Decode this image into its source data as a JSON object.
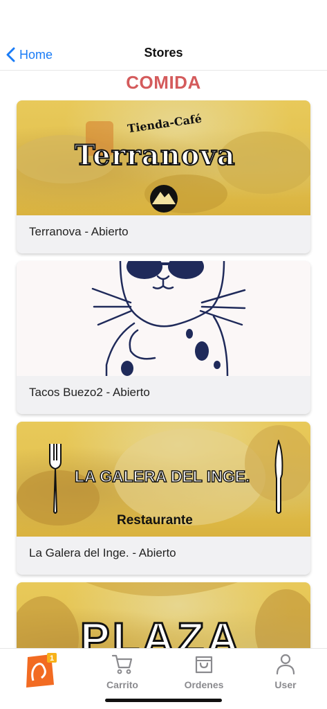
{
  "nav": {
    "back_label": "Home",
    "title": "Stores"
  },
  "section": {
    "title": "COMIDA"
  },
  "stores": [
    {
      "label": "Terranova - Abierto",
      "logo_top": "Tienda-Café",
      "logo_main": "Terranova"
    },
    {
      "label": "Tacos Buezo2 - Abierto"
    },
    {
      "label": "La Galera del Inge. - Abierto",
      "logo_main": "LA GALERA DEL INGE.",
      "logo_sub": "Restaurante"
    },
    {
      "logo_main": "PLAZA"
    }
  ],
  "tabs": {
    "home_badge": "1",
    "cart_label": "Carrito",
    "orders_label": "Ordenes",
    "user_label": "User"
  },
  "colors": {
    "accent": "#1a7cf6",
    "section_title": "#d45b5c",
    "tab_label": "#8a8a8e",
    "home_tab": "#f26b22"
  },
  "icons": [
    "chevron-left-icon",
    "app-logo-icon",
    "cart-icon",
    "shopping-bag-icon",
    "user-icon"
  ]
}
